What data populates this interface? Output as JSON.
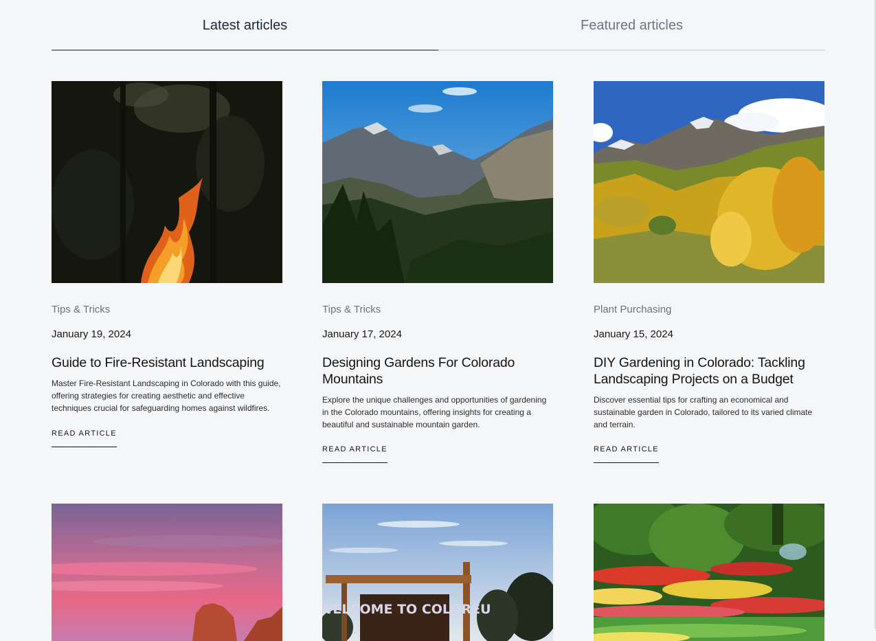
{
  "tabs": [
    {
      "label": "Latest articles",
      "active": true
    },
    {
      "label": "Featured articles",
      "active": false
    }
  ],
  "articles": [
    {
      "image": "campfire-in-dark-forest",
      "category": "Tips & Tricks",
      "date": "January 19, 2024",
      "title": "Guide to Fire-Resistant Landscaping",
      "excerpt": "Master Fire-Resistant Landscaping in Colorado with this guide, offering strategies for creating aesthetic and effective techniques crucial for safeguarding homes against wildfires.",
      "cta": "READ ARTICLE"
    },
    {
      "image": "colorado-mountain-valley-pine-forest",
      "category": "Tips & Tricks",
      "date": "January 17, 2024",
      "title": "Designing Gardens For Colorado Mountains",
      "excerpt": "Explore the unique challenges and opportunities of gardening in the Colorado mountains, offering insights for creating a beautiful and sustainable mountain garden.",
      "cta": "READ ARTICLE"
    },
    {
      "image": "autumn-aspens-mountain-range",
      "category": "Plant Purchasing",
      "date": "January 15, 2024",
      "title": "DIY Gardening in Colorado: Tackling Landscaping Projects on a Budget",
      "excerpt": "Discover essential tips for crafting an economical and sustainable garden in Colorado, tailored to its varied climate and terrain.",
      "cta": "READ ARTICLE"
    },
    {
      "image": "pink-sunset-red-rocks"
    },
    {
      "image": "welcome-to-colorful-colorado-sign",
      "sign_text": "WELCOME TO COLOREU"
    },
    {
      "image": "lush-flower-garden"
    }
  ],
  "colors": {
    "background": "#f5f6f8",
    "active_tab_text": "#1b2638",
    "inactive_tab_text": "#6b7683",
    "category_text": "#6d7278"
  }
}
